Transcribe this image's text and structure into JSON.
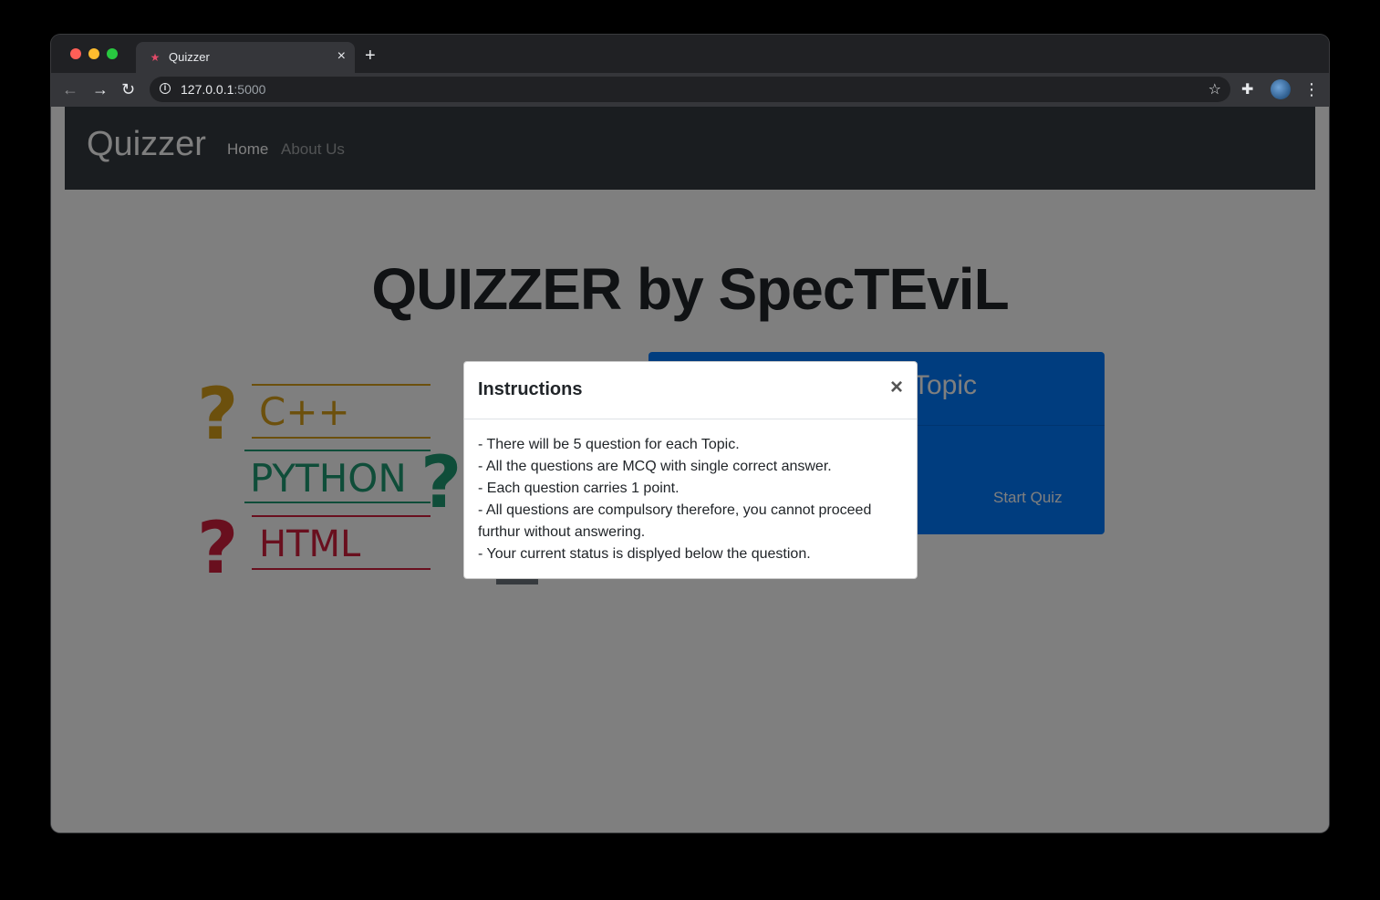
{
  "browser": {
    "tab_title": "Quizzer",
    "tab_close": "×",
    "new_tab": "+",
    "url_host": "127.0.0.1",
    "url_port": ":5000",
    "back": "←",
    "forward": "→",
    "reload": "↻",
    "info": "i",
    "star": "☆",
    "extensions": "✚",
    "menu": "⋮"
  },
  "navbar": {
    "brand": "Quizzer",
    "links": [
      "Home",
      "About Us"
    ]
  },
  "hero": {
    "title": "QUIZZER by SpecTEviL"
  },
  "logo": {
    "words": [
      "C++",
      "PYTHON",
      "HTML"
    ],
    "colors": [
      "#d8a01b",
      "#1f9a73",
      "#d21f3c"
    ]
  },
  "topic_card": {
    "title_visible": "Topic",
    "button": "Start Quiz",
    "color": "#007bff"
  },
  "modal": {
    "title": "Instructions",
    "close": "×",
    "lines": [
      "- There will be 5 question for each Topic.",
      "- All the questions are MCQ with single correct answer.",
      "- Each question carries 1 point.",
      "- All questions are compulsory therefore, you cannot proceed furthur without answering.",
      "- Your current status is displyed below the question."
    ]
  }
}
